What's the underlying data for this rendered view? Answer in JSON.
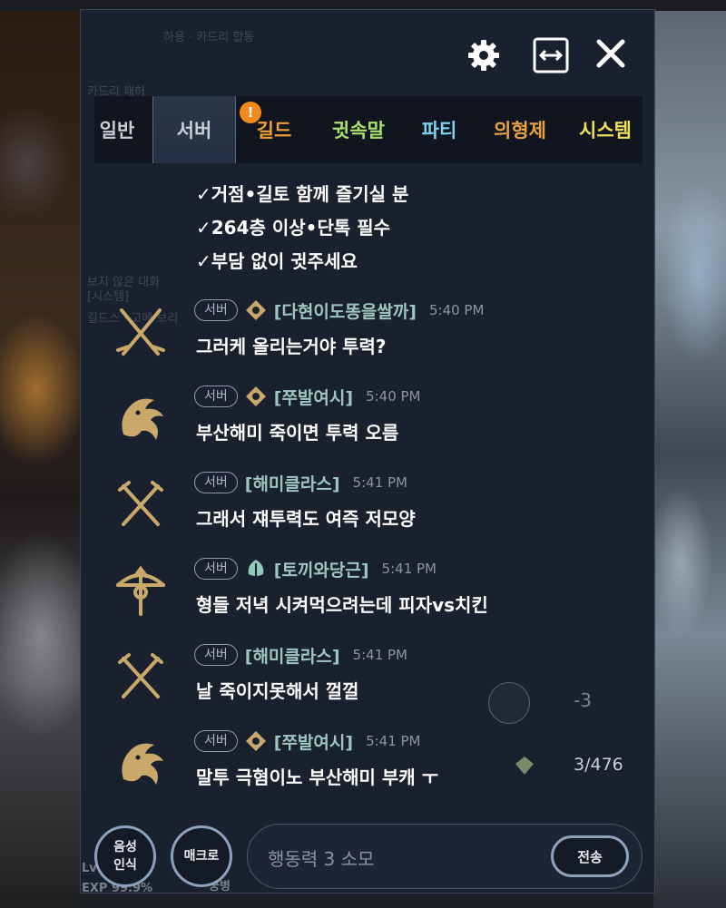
{
  "window": {
    "settings_icon": "gear-icon",
    "expand_icon": "horizontal-resize-icon",
    "close_icon": "close-icon"
  },
  "background_hud": {
    "ghost_title": "하용 · 카드리 합동",
    "ghost_label1": "카드리 패허",
    "ghost_label2": "보지 않은 대화",
    "ghost_label3": "[시스템]",
    "ghost_label4": "길드스 · 고메 보리",
    "lv": "Lv",
    "exp": "EXP 99.9%",
    "bottom_label": "궁병"
  },
  "tabs": [
    {
      "label": "일반",
      "color": "#c9ced6",
      "active": false
    },
    {
      "label": "서버",
      "color": "#c9ced6",
      "active": true
    },
    {
      "label": "길드",
      "color": "#f0a030",
      "active": false,
      "badge": "!"
    },
    {
      "label": "귓속말",
      "color": "#a8e06a",
      "active": false
    },
    {
      "label": "파티",
      "color": "#7ed4f0",
      "active": false
    },
    {
      "label": "의형제",
      "color": "#e8a040",
      "active": false
    },
    {
      "label": "시스템",
      "color": "#f0e060",
      "active": false
    }
  ],
  "continued_lines": [
    "✓거점•길토 함께 즐기실 분",
    "✓264층 이상•단톡 필수",
    "✓부담 없이 귓주세요"
  ],
  "messages": [
    {
      "channel": "서버",
      "icon": "crossed-sabers-icon",
      "rank_icon": "diamond-emblem-icon",
      "name": "[다현이도똥을쌀까]",
      "time": "5:40 PM",
      "text": "그러케 올리는거야 투력?"
    },
    {
      "channel": "서버",
      "icon": "dragon-icon",
      "rank_icon": "diamond-emblem-icon",
      "name": "[쭈발여시]",
      "time": "5:40 PM",
      "text": "부산해미 죽이면 투력 오름"
    },
    {
      "channel": "서버",
      "icon": "crossed-swords-icon",
      "rank_icon": "",
      "name": "[해미클라스]",
      "time": "5:41 PM",
      "text": "그래서 쟤투력도 여즉 저모양"
    },
    {
      "channel": "서버",
      "icon": "bow-icon",
      "rank_icon": "leaf-emblem-icon",
      "name": "[토끼와당근]",
      "time": "5:41 PM",
      "text": "형들 저녁 시켜먹으려는데 피자vs치킨"
    },
    {
      "channel": "서버",
      "icon": "crossed-swords-icon",
      "rank_icon": "",
      "name": "[해미클라스]",
      "time": "5:41 PM",
      "text": "날 죽이지못해서 껄껄"
    },
    {
      "channel": "서버",
      "icon": "dragon-icon",
      "rank_icon": "diamond-emblem-icon",
      "name": "[쭈발여시]",
      "time": "5:41 PM",
      "text": "말투 극혐이노 부산해미 부캐 ㅜ"
    }
  ],
  "overlay": {
    "minus_value": "-3",
    "count": "3/476"
  },
  "input": {
    "voice_label_line1": "음성",
    "voice_label_line2": "인식",
    "macro_label": "매크로",
    "placeholder": "행동력 3 소모",
    "send_label": "전송"
  },
  "colors": {
    "gold": "#c9a86a",
    "name": "#9fc6c0"
  }
}
